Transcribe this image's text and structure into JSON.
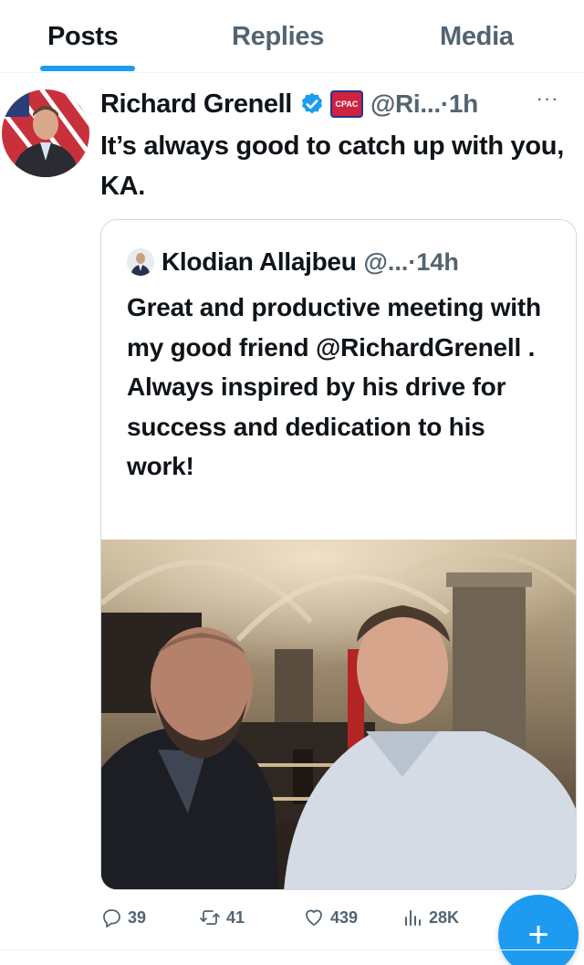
{
  "tabs": [
    {
      "label": "Posts",
      "active": true
    },
    {
      "label": "Replies",
      "active": false
    },
    {
      "label": "Media",
      "active": false
    }
  ],
  "post": {
    "author_name": "Richard Grenell",
    "handle": "@Ri...",
    "separator": "·",
    "time": "1h",
    "more_icon": "more-horizontal-icon",
    "badge_text": "CPAC",
    "text": "It’s always good to catch up with you, KA."
  },
  "quote": {
    "author_name": "Klodian Allajbeu",
    "handle": "@...",
    "separator": "·",
    "time": "14h",
    "text": "Great and productive meeting with my good friend @RichardGrenell . Always inspired by his drive for success and dedication to his work!"
  },
  "actions": {
    "replies": "39",
    "reposts": "41",
    "likes": "439",
    "views": "28K"
  },
  "fab": {
    "label": "+"
  },
  "colors": {
    "accent": "#1d9bf0",
    "text": "#0f1419",
    "muted": "#536471",
    "border": "#cfd9de"
  }
}
